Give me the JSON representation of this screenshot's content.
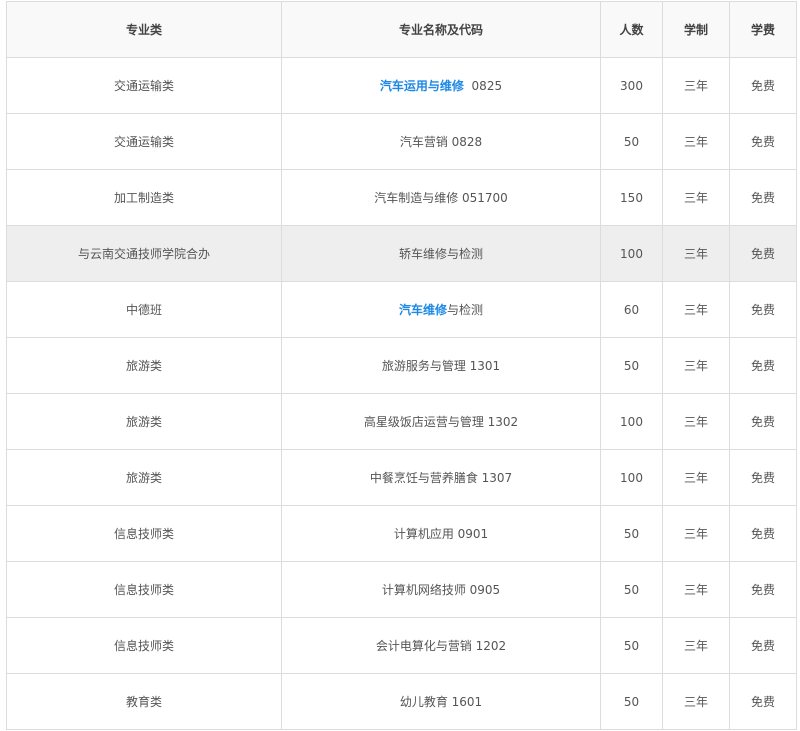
{
  "table": {
    "headers": [
      "专业类",
      "专业名称及代码",
      "人数",
      "学制",
      "学费"
    ],
    "rows": [
      {
        "category": "交通运输类",
        "name_link": "汽车运用与维修",
        "name_rest": "  0825",
        "count": "300",
        "duration": "三年",
        "fee": "免费"
      },
      {
        "category": "交通运输类",
        "name_link": "",
        "name_rest": "汽车营销 0828",
        "count": "50",
        "duration": "三年",
        "fee": "免费"
      },
      {
        "category": "加工制造类",
        "name_link": "",
        "name_rest": "汽车制造与维修 051700",
        "count": "150",
        "duration": "三年",
        "fee": "免费"
      },
      {
        "category": "与云南交通技师学院合办",
        "name_link": "",
        "name_rest": "轿车维修与检测",
        "count": "100",
        "duration": "三年",
        "fee": "免费"
      },
      {
        "category": "中德班",
        "name_link": "汽车维修",
        "name_rest": "与检测",
        "count": "60",
        "duration": "三年",
        "fee": "免费"
      },
      {
        "category": "旅游类",
        "name_link": "",
        "name_rest": "旅游服务与管理 1301",
        "count": "50",
        "duration": "三年",
        "fee": "免费"
      },
      {
        "category": "旅游类",
        "name_link": "",
        "name_rest": "高星级饭店运营与管理 1302",
        "count": "100",
        "duration": "三年",
        "fee": "免费"
      },
      {
        "category": "旅游类",
        "name_link": "",
        "name_rest": "中餐烹饪与营养膳食 1307",
        "count": "100",
        "duration": "三年",
        "fee": "免费"
      },
      {
        "category": "信息技师类",
        "name_link": "",
        "name_rest": "计算机应用 0901",
        "count": "50",
        "duration": "三年",
        "fee": "免费"
      },
      {
        "category": "信息技师类",
        "name_link": "",
        "name_rest": "计算机网络技师 0905",
        "count": "50",
        "duration": "三年",
        "fee": "免费"
      },
      {
        "category": "信息技师类",
        "name_link": "",
        "name_rest": "会计电算化与营销 1202",
        "count": "50",
        "duration": "三年",
        "fee": "免费"
      },
      {
        "category": "教育类",
        "name_link": "",
        "name_rest": "幼儿教育 1601",
        "count": "50",
        "duration": "三年",
        "fee": "免费"
      }
    ]
  },
  "colors": {
    "link": "#1e88e5",
    "highlight_row": "#eeeeee",
    "border": "#dcdcdc"
  }
}
